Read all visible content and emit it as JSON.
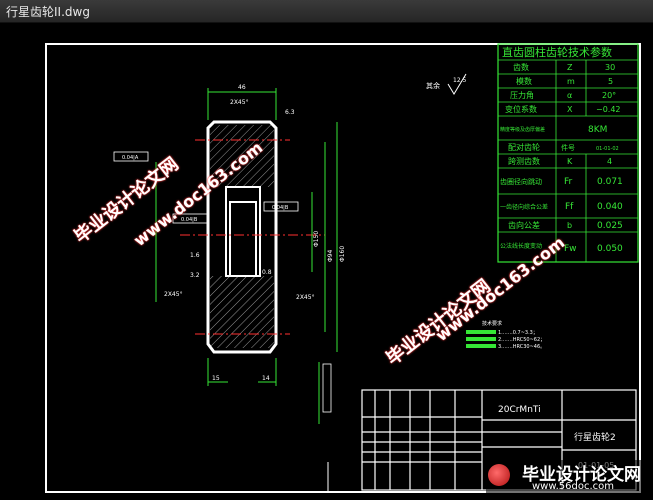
{
  "window": {
    "title": "行星齿轮II.dwg"
  },
  "params": {
    "title": "直齿圆柱齿轮技术参数",
    "rows": [
      {
        "name": "齿数",
        "sym": "Z",
        "val": "30"
      },
      {
        "name": "模数",
        "sym": "m",
        "val": "5"
      },
      {
        "name": "压力角",
        "sym": "α",
        "val": "20°"
      },
      {
        "name": "变位系数",
        "sym": "X",
        "val": "−0.42"
      },
      {
        "name": "精度等级及齿厚偏差",
        "val": "8KM"
      },
      {
        "name": "配对齿轮",
        "sym": "件号",
        "val": "01-01-02"
      },
      {
        "name": "跨测齿数",
        "sym": "K",
        "val": "4"
      },
      {
        "name": "齿圈径向跳动",
        "sym": "Fr",
        "val": "0.071"
      },
      {
        "name": "一齿径向综合公差",
        "sym": "Ff",
        "val": "0.040"
      },
      {
        "name": "齿向公差",
        "sym": "b",
        "val": "0.025"
      },
      {
        "name": "公法线长度变动",
        "sym": "Fw",
        "val": "0.050"
      }
    ]
  },
  "drawing": {
    "roughness_label": "其余",
    "roughness_value": "12.5",
    "dim_top": "46",
    "chamfer_top": "2X45°",
    "chamfer_left": "2X45°",
    "chamfer_right": "2X45°",
    "roughness_top_right": "6.3",
    "dim_bottom_left": "15",
    "dim_bottom_right": "14",
    "dia_large": "Φ160",
    "dia_mid": "Φ94",
    "dia_small": "Φ150",
    "gtol_1": "0.04|A",
    "gtol_2": "0.04|B",
    "gtol_3": "0.04|B",
    "roughness_a": "1.6",
    "roughness_b": "3.2",
    "roughness_c": "0.8",
    "tech_title": "技术要求",
    "tech_lines": [
      "1.……0.7~3.3；",
      "2.……HRC50~62；",
      "3.……HRC30~46。"
    ]
  },
  "title_block": {
    "material": "20CrMnTi",
    "part_name": "行星齿轮2",
    "drawing_no": "01-01-05"
  },
  "watermarks": {
    "w1": "毕业设计论文网",
    "w2": "www.doc163.com",
    "brand_cn": "毕业设计论文网",
    "brand_url": "www.56doc.com"
  }
}
